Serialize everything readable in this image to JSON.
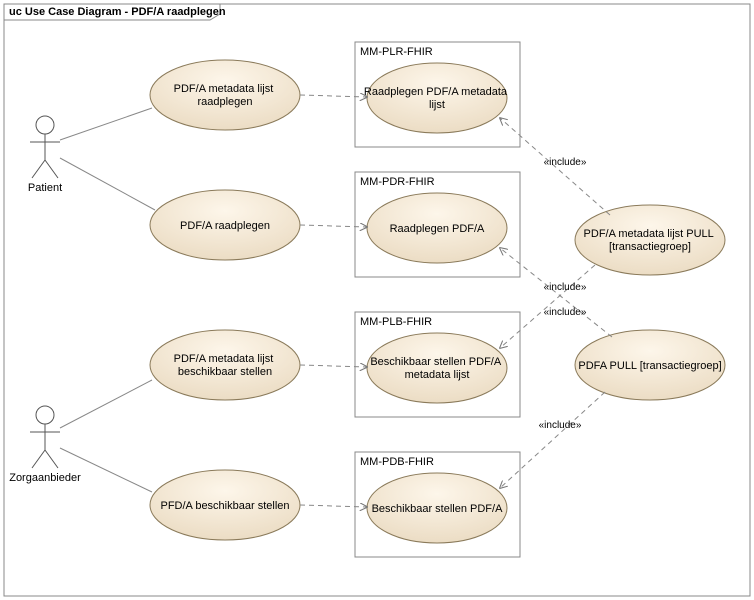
{
  "frame": {
    "title": "uc Use Case Diagram - PDF/A raadplegen"
  },
  "actors": {
    "patient": "Patient",
    "zorgaanbieder": "Zorgaanbieder"
  },
  "usecases": {
    "left": {
      "metaList": "PDF/A metadata lijst raadplegen",
      "raadplegen": "PDF/A raadplegen",
      "metaBeschikbaar": "PDF/A metadata lijst beschikbaar stellen",
      "pfdBeschikbaar": "PFD/A beschikbaar stellen"
    },
    "boxed": {
      "plr": {
        "box": "MM-PLR-FHIR",
        "uc": "Raadplegen PDF/A metadata lijst"
      },
      "pdr": {
        "box": "MM-PDR-FHIR",
        "uc": "Raadplegen PDF/A"
      },
      "plb": {
        "box": "MM-PLB-FHIR",
        "uc": "Beschikbaar stellen PDF/A metadata lijst"
      },
      "pdb": {
        "box": "MM-PDB-FHIR",
        "uc": "Beschikbaar stellen PDF/A"
      }
    },
    "right": {
      "metaPull": "PDF/A metadata lijst PULL [transactiegroep]",
      "pdfaPull": "PDFA PULL [transactiegroep]"
    }
  },
  "include": "«include»"
}
